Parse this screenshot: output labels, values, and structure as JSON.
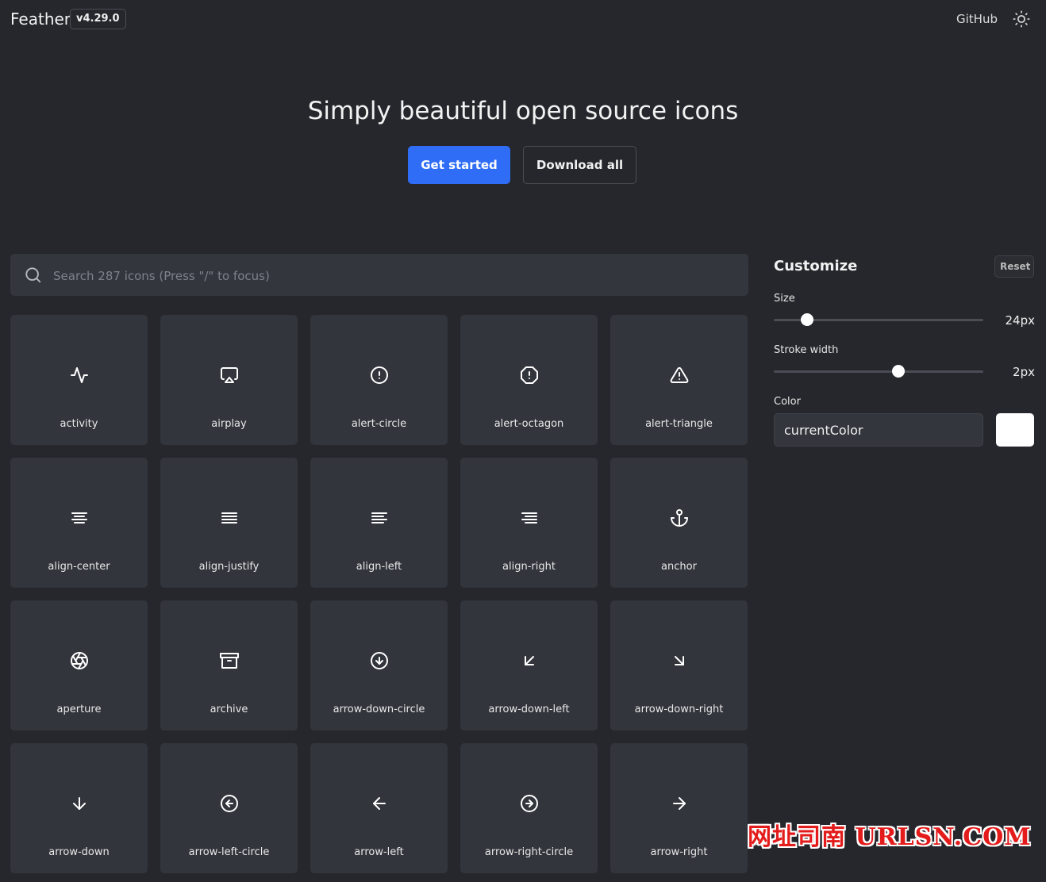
{
  "header": {
    "logo": "Feather",
    "version": "v4.29.0",
    "github_label": "GitHub",
    "theme_icon": "sun-icon"
  },
  "hero": {
    "title": "Simply beautiful open source icons",
    "get_started": "Get started",
    "download_all": "Download all"
  },
  "search": {
    "placeholder": "Search 287 icons (Press \"/\" to focus)",
    "value": ""
  },
  "icons": [
    "activity",
    "airplay",
    "alert-circle",
    "alert-octagon",
    "alert-triangle",
    "align-center",
    "align-justify",
    "align-left",
    "align-right",
    "anchor",
    "aperture",
    "archive",
    "arrow-down-circle",
    "arrow-down-left",
    "arrow-down-right",
    "arrow-down",
    "arrow-left-circle",
    "arrow-left",
    "arrow-right-circle",
    "arrow-right"
  ],
  "customize": {
    "title": "Customize",
    "reset": "Reset",
    "size_label": "Size",
    "size_value": "24px",
    "size_fraction": 0.16,
    "stroke_label": "Stroke width",
    "stroke_value": "2px",
    "stroke_fraction": 0.595,
    "color_label": "Color",
    "color_value": "currentColor",
    "swatch_color": "#ffffff"
  },
  "colors": {
    "accent": "#2f6df6",
    "background": "#25272c",
    "tile": "#32353c"
  },
  "watermark": "网址司南 URLSN.COM"
}
